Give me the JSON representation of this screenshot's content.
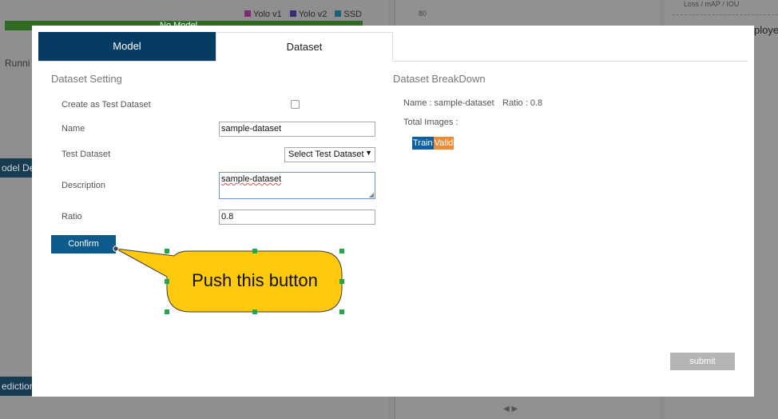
{
  "background": {
    "legend": [
      {
        "label": "Yolo v1",
        "color": "#7d2a6f"
      },
      {
        "label": "Yolo v2",
        "color": "#3d2a6f"
      },
      {
        "label": "SSD",
        "color": "#1f5f7a"
      }
    ],
    "bar_text": "No Model",
    "running_label": "Runni",
    "side_buttons": [
      "odel De",
      "ediction"
    ],
    "axis_tick": "80",
    "metrics_header": "Loss  /  mAP  /  IOU",
    "deployed_fragment": "ployec",
    "arrows": "◀ ▶"
  },
  "modal": {
    "tabs": [
      {
        "label": "Model",
        "active": false
      },
      {
        "label": "Dataset",
        "active": true
      }
    ],
    "settings": {
      "title": "Dataset Setting",
      "create_test_label": "Create as Test Dataset",
      "create_test_checked": false,
      "name_label": "Name",
      "name_value": "sample-dataset",
      "test_dataset_label": "Test Dataset",
      "test_dataset_selected": "Select Test Dataset",
      "description_label": "Description",
      "description_value": "sample-dataset",
      "ratio_label": "Ratio",
      "ratio_value": "0.8",
      "confirm_label": "Confirm"
    },
    "breakdown": {
      "title": "Dataset BreakDown",
      "name_line": "Name : sample-dataset",
      "ratio_line": "Ratio : 0.8",
      "total_images_label": "Total Images :",
      "train_label": "Train",
      "valid_label": "Valid",
      "train_color": "#0b5fa5",
      "valid_color": "#f08a32"
    },
    "submit_label": "submit"
  },
  "callout": {
    "text": "Push this button",
    "fill": "#ffc90e"
  }
}
